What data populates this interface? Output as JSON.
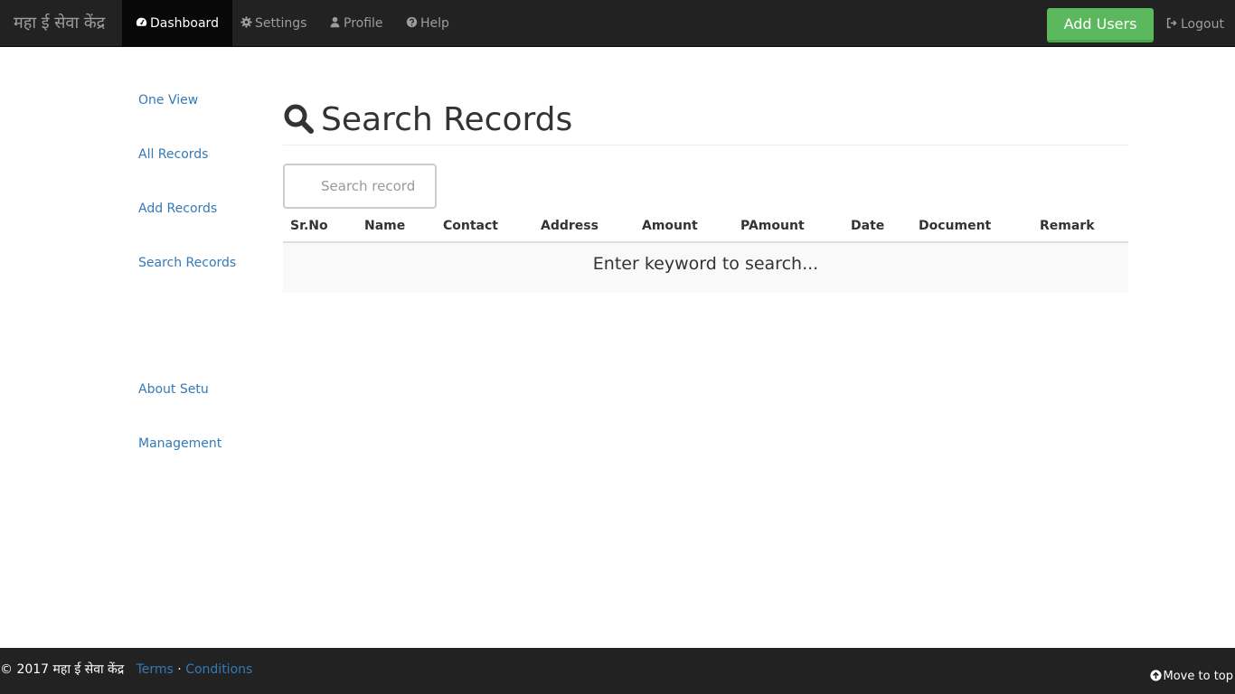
{
  "navbar": {
    "brand": "महा ई सेवा केंद्र",
    "items": [
      {
        "label": "Dashboard",
        "icon": "dashboard-icon",
        "active": true
      },
      {
        "label": "Settings",
        "icon": "gear-icon",
        "active": false
      },
      {
        "label": "Profile",
        "icon": "user-icon",
        "active": false
      },
      {
        "label": "Help",
        "icon": "question-circle-icon",
        "active": false
      }
    ],
    "add_users_label": "Add Users",
    "logout_label": "Logout"
  },
  "sidebar": {
    "items": [
      {
        "label": "One View"
      },
      {
        "label": "All Records"
      },
      {
        "label": "Add Records"
      },
      {
        "label": "Search Records"
      },
      {
        "label": "About Setu"
      },
      {
        "label": "Management"
      }
    ]
  },
  "main": {
    "title": "Search Records",
    "search": {
      "placeholder": "Search record",
      "value": ""
    },
    "table": {
      "columns": [
        "Sr.No",
        "Name",
        "Contact",
        "Address",
        "Amount",
        "PAmount",
        "Date",
        "Document",
        "Remark"
      ],
      "empty_message": "Enter keyword to search..."
    }
  },
  "footer": {
    "copyright": "© 2017 महा ई सेवा केंद्र",
    "terms_label": "Terms",
    "separator": "·",
    "conditions_label": "Conditions",
    "move_top_label": "Move to top"
  },
  "colors": {
    "navbar_bg": "#222222",
    "link": "#337ab7",
    "success": "#5cb85c"
  }
}
